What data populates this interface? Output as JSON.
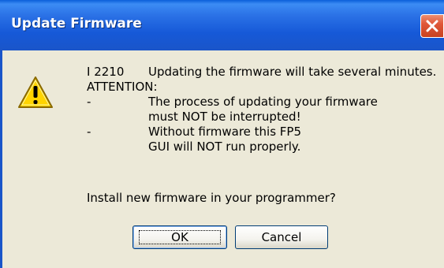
{
  "window": {
    "title": "Update Firmware",
    "close_icon": "close-icon"
  },
  "dialog": {
    "icon": "warning-icon",
    "code": "I 2210",
    "message": "Updating the firmware will take several minutes.",
    "attention": "ATTENTION:",
    "bullet1_dash": "-",
    "bullet1_line1": "The process of updating your firmware",
    "bullet1_line2": "must NOT be interrupted!",
    "bullet2_dash": "-",
    "bullet2_line1": "Without firmware this FP5",
    "bullet2_line2": "GUI will NOT run properly.",
    "question": "Install new firmware in your programmer?"
  },
  "buttons": {
    "ok_label": "OK",
    "cancel_label": "Cancel"
  },
  "colors": {
    "titlebar": "#2B72E6",
    "dialog_bg": "#ECE9D8",
    "close_button": "#E0583A",
    "warning_yellow": "#FFD400"
  }
}
